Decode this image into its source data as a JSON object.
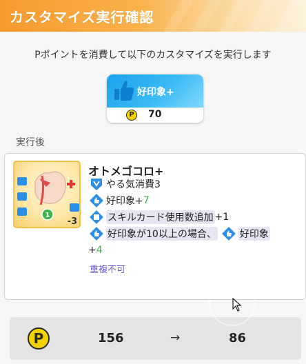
{
  "header": {
    "title": "カスタマイズ実行確認"
  },
  "description": "Pポイントを消費して以下のカスタマイズを実行します",
  "customization": {
    "name": "好印象+",
    "currency_symbol": "P",
    "cost": "70",
    "icon": "thumbs-up-icon"
  },
  "after_label": "実行後",
  "skill_card": {
    "name": "オトメゴコロ+",
    "lines": [
      {
        "icon": "motivation-icon",
        "text": "やる気消費3"
      },
      {
        "icon": "thumbs-up-icon",
        "text": "好印象+",
        "value": "7"
      },
      {
        "icon": "card-icon",
        "text": "スキルカード使用数追加",
        "suffix": "+1"
      },
      {
        "icon": "thumbs-up-icon",
        "text": "好印象が10以上の場合、",
        "text2": "好印象"
      },
      {
        "text": "+",
        "value": "4"
      }
    ],
    "note": "重複不可",
    "art_badge_left": "1",
    "art_badge_right": "-3"
  },
  "cost_summary": {
    "currency_symbol": "P",
    "before": "156",
    "arrow": "→",
    "after": "86"
  },
  "colors": {
    "header_orange": "#f79a2d",
    "boost_blue": "#1aa2ec",
    "coin_yellow": "#f5d300",
    "value_green": "#3bb24a",
    "note_purple": "#6a5acd"
  }
}
